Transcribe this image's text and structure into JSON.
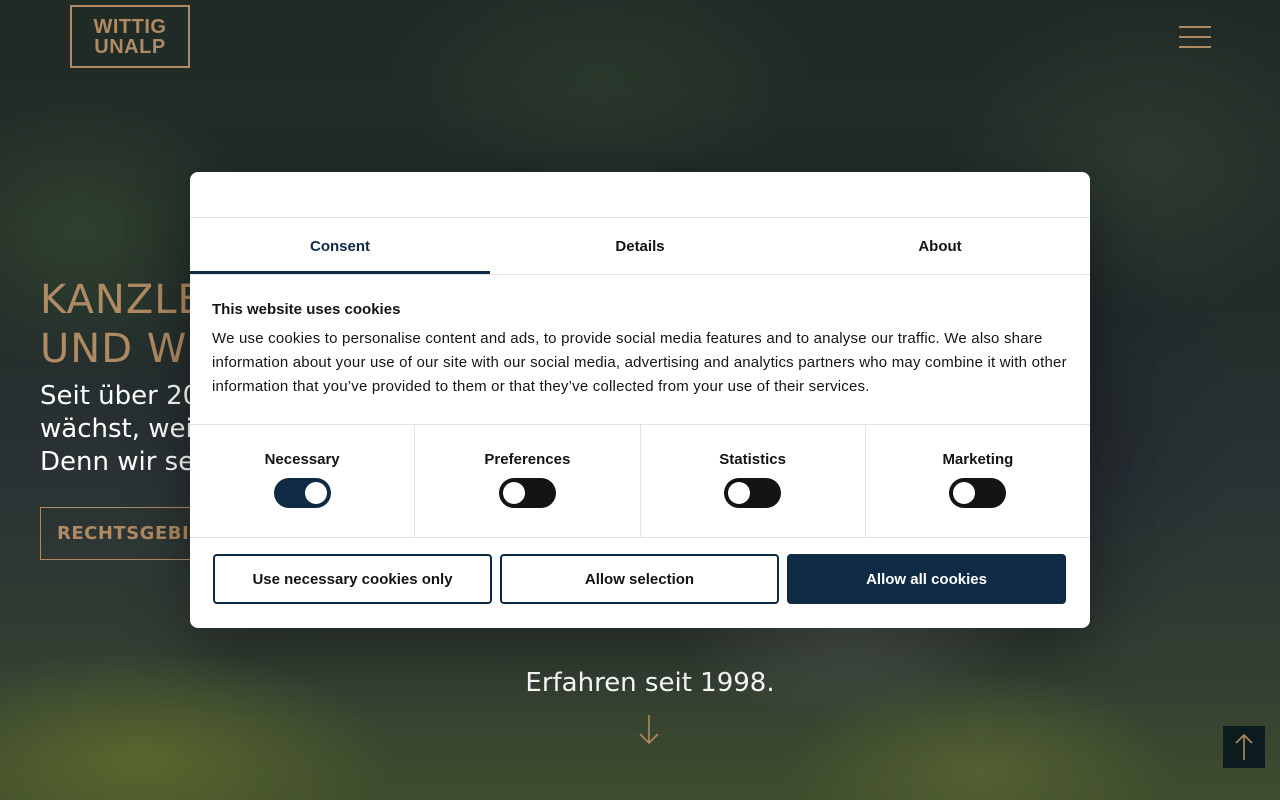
{
  "header": {
    "logo_line1": "WITTIG",
    "logo_line2": "UNALP",
    "menu_icon": "hamburger-menu-icon"
  },
  "hero": {
    "title_line1": "KANZLE",
    "title_line2": "UND WI",
    "subtitle_line1": "Seit über 20",
    "subtitle_line2": "wächst, weil",
    "subtitle_line3": "Denn wir se",
    "button_label": "RECHTSGEBIET",
    "since": "Erfahren seit 1998.",
    "down_icon": "arrow-down-icon",
    "top_icon": "arrow-up-icon"
  },
  "cookie_dialog": {
    "tabs": [
      {
        "label": "Consent",
        "active": true
      },
      {
        "label": "Details",
        "active": false
      },
      {
        "label": "About",
        "active": false
      }
    ],
    "heading": "This website uses cookies",
    "body": "We use cookies to personalise content and ads, to provide social media features and to analyse our traffic. We also share information about your use of our site with our social media, advertising and analytics partners who may combine it with other information that you’ve provided to them or that they’ve collected from your use of their services.",
    "categories": [
      {
        "label": "Necessary",
        "checked": true
      },
      {
        "label": "Preferences",
        "checked": false
      },
      {
        "label": "Statistics",
        "checked": false
      },
      {
        "label": "Marketing",
        "checked": false
      }
    ],
    "buttons": {
      "necessary_only": "Use necessary cookies only",
      "allow_selection": "Allow selection",
      "allow_all": "Allow all cookies"
    }
  },
  "colors": {
    "brand_gold": "#b08a62",
    "dialog_navy": "#0f2a45",
    "to_top_bg": "#0c1c1e"
  }
}
